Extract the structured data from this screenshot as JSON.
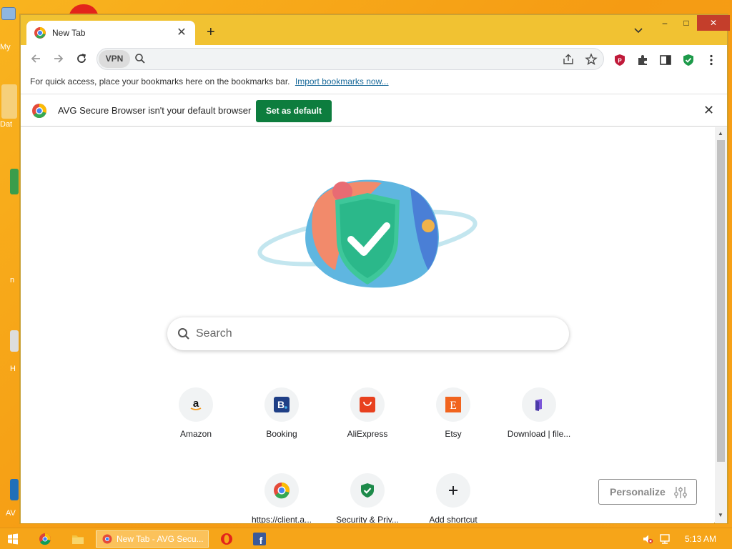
{
  "desktop": {
    "icon_labels": [
      "My",
      "Dat",
      "n",
      "H",
      "AV"
    ]
  },
  "browser": {
    "tab_title": "New Tab",
    "tab_close": "✕",
    "new_tab": "+",
    "tab_search": "⌄",
    "window_controls": {
      "minimize": "–",
      "maximize": "□",
      "close": "✕"
    },
    "vpn_label": "VPN",
    "omnibox_value": "",
    "bookmark_bar_text": "For quick access, place your bookmarks here on the bookmarks bar.",
    "import_link": "Import bookmarks now...",
    "infobar_text": "AVG Secure Browser isn't your default browser",
    "set_default_label": "Set as default",
    "infobar_close": "✕"
  },
  "newtab": {
    "search_placeholder": "Search",
    "shortcuts": [
      {
        "label": "Amazon",
        "icon": "amazon-icon"
      },
      {
        "label": "Booking",
        "icon": "booking-icon"
      },
      {
        "label": "AliExpress",
        "icon": "aliexpress-icon"
      },
      {
        "label": "Etsy",
        "icon": "etsy-icon"
      },
      {
        "label": "Download | file...",
        "icon": "download-file-icon"
      },
      {
        "label": "https://client.a...",
        "icon": "avg-client-icon"
      },
      {
        "label": "Security & Priv...",
        "icon": "shield-check-icon"
      },
      {
        "label": "Add shortcut",
        "icon": "plus-icon"
      }
    ],
    "personalize_label": "Personalize"
  },
  "taskbar": {
    "active_window": "New Tab - AVG Secu...",
    "clock": "5:13 AM"
  },
  "colors": {
    "accent_green": "#0d7d3e",
    "titlebar": "#f1c232",
    "desktop": "#f7a718"
  }
}
